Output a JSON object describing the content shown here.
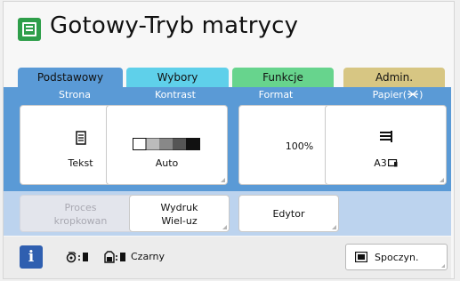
{
  "header": {
    "title": "Gotowy-Tryb matrycy",
    "icon": "master-mode-icon"
  },
  "tabs": [
    {
      "label": "Podstawowy",
      "active": true
    },
    {
      "label": "Wybory"
    },
    {
      "label": "Funkcje"
    },
    {
      "label": "Admin."
    }
  ],
  "settings": {
    "page": {
      "header": "Strona",
      "value": "Tekst",
      "icon": "document-text-icon"
    },
    "contrast": {
      "header": "Kontrast",
      "value": "Auto",
      "icon": "contrast-scale-icon"
    },
    "format": {
      "header": "Format",
      "value": "100%"
    },
    "paper": {
      "header": "Papier(",
      "header_suffix": ")",
      "value": "A3",
      "icon": "paper-stack-icon"
    }
  },
  "actions": {
    "dot_process": {
      "line1": "Proces",
      "line2": "kropkowan",
      "enabled": false
    },
    "multi_print": {
      "line1": "Wydruk",
      "line2": "Wiel-uz"
    },
    "editor": {
      "label": "Edytor"
    }
  },
  "status": {
    "info_label": "i",
    "ink_label": "Czarny",
    "standby_label": "Spoczyn."
  },
  "colors": {
    "title_icon": "#2e9e4a",
    "tab_basic": "#5a9ad6",
    "tab_options": "#5fd0ea",
    "tab_functions": "#67d48d",
    "tab_admin": "#d7c683",
    "info_button": "#2f5fb0"
  }
}
